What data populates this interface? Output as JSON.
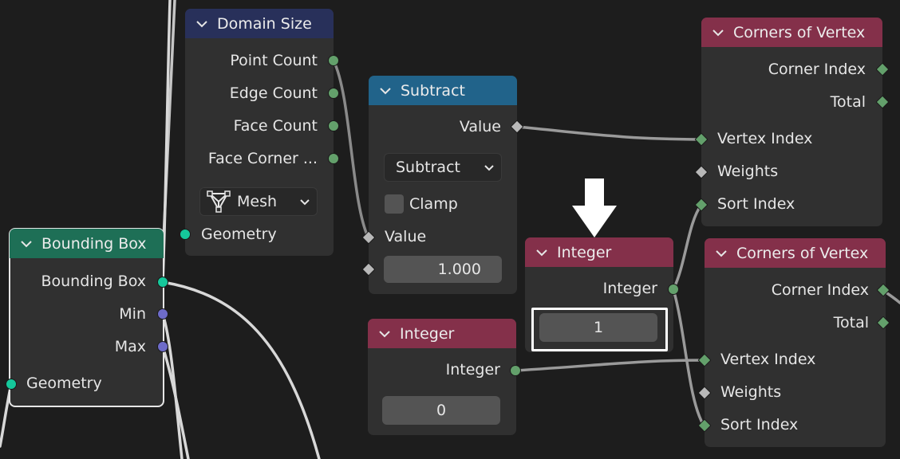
{
  "nodes": {
    "domain_size": {
      "title": "Domain Size",
      "outputs": [
        "Point Count",
        "Edge Count",
        "Face Count",
        "Face Corner ..."
      ],
      "domain_value": "Mesh",
      "input": "Geometry"
    },
    "subtract": {
      "title": "Subtract",
      "output": "Value",
      "operation": "Subtract",
      "clamp_label": "Clamp",
      "input_a": "Value",
      "input_b_value": "1.000"
    },
    "corners_top": {
      "title": "Corners of Vertex",
      "outputs": [
        "Corner Index",
        "Total"
      ],
      "inputs": [
        "Vertex Index",
        "Weights",
        "Sort Index"
      ]
    },
    "integer_selected": {
      "title": "Integer",
      "output": "Integer",
      "value": "1"
    },
    "corners_bottom": {
      "title": "Corners of Vertex",
      "outputs": [
        "Corner Index",
        "Total"
      ],
      "inputs": [
        "Vertex Index",
        "Weights",
        "Sort Index"
      ]
    },
    "integer_zero": {
      "title": "Integer",
      "output": "Integer",
      "value": "0"
    },
    "bounding_box": {
      "title": "Bounding Box",
      "outputs": [
        "Bounding Box",
        "Min",
        "Max"
      ],
      "input": "Geometry"
    }
  },
  "colors": {
    "background": "#1d1d1d",
    "node_body": "#303030",
    "header_geometry": "#28305a",
    "header_math": "#21638a",
    "header_input": "#84304a",
    "header_bbox": "#1e6f56",
    "socket_geometry": "#15c89b",
    "socket_integer": "#63a06b",
    "socket_vector": "#6d6bc8",
    "socket_float": "#b8b8b8",
    "wire": "#d8d8d8"
  },
  "icons": [
    "chevron-down-icon",
    "mesh-icon",
    "arrow-down-icon"
  ]
}
